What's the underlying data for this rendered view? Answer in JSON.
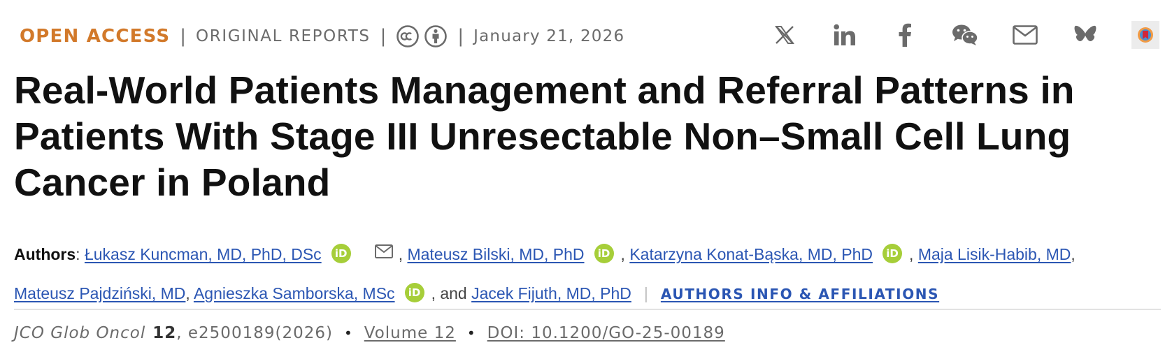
{
  "meta": {
    "access_label": "OPEN ACCESS",
    "article_type": "ORIGINAL REPORTS",
    "separator": "|",
    "date": "January 21, 2026",
    "license_icons": [
      "creative-commons-icon",
      "attribution-icon"
    ],
    "access_color": "#d2792a"
  },
  "share": {
    "icons": [
      "x-icon",
      "linkedin-icon",
      "facebook-icon",
      "wechat-icon",
      "email-icon",
      "bluesky-icon",
      "mendeley-icon"
    ]
  },
  "article": {
    "title": "Real-World Patients Management and Referral Patterns in Patients With Stage III Unresectable Non–Small Cell Lung Cancer in Poland"
  },
  "authors": {
    "label": "Authors",
    "colon": ": ",
    "comma": ", ",
    "and": ", and ",
    "orcid_text": "iD",
    "list": [
      {
        "name": "Łukasz Kuncman, MD, PhD, DSc",
        "orcid": true,
        "email": true
      },
      {
        "name": "Mateusz Bilski, MD, PhD",
        "orcid": true
      },
      {
        "name": "Katarzyna Konat-Bąska, MD, PhD",
        "orcid": true
      },
      {
        "name": "Maja Lisik-Habib, MD",
        "orcid": false
      },
      {
        "name": "Mateusz Pajdziński, MD",
        "orcid": false
      },
      {
        "name": "Agnieszka Samborska, MSc",
        "orcid": true
      },
      {
        "name": "Jacek Fijuth, MD, PhD",
        "orcid": false
      }
    ],
    "affiliations_link": "AUTHORS INFO & AFFILIATIONS",
    "link_color": "#2b56b3",
    "orcid_color": "#a6ce39"
  },
  "citation": {
    "journal": "JCO Glob Oncol",
    "volume_number": "12",
    "article_id": ", e2500189(2026)",
    "bullet": "•",
    "volume_link": "Volume 12",
    "doi_link": "DOI: 10.1200/GO-25-00189"
  }
}
